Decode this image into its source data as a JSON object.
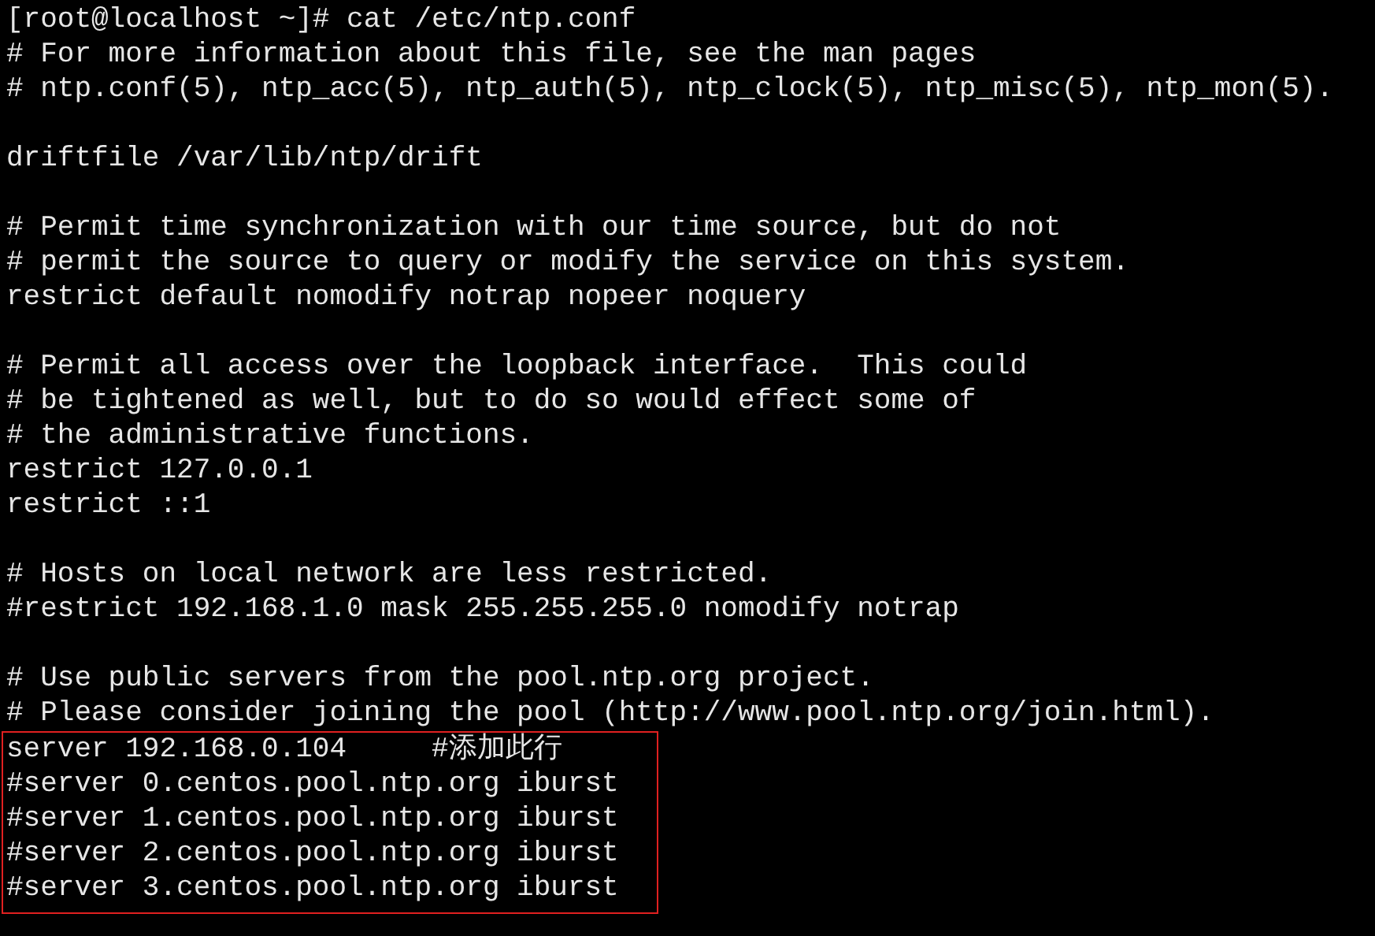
{
  "terminal": {
    "blocks": [
      {
        "lines": [
          "[root@localhost ~]# cat /etc/ntp.conf",
          "# For more information about this file, see the man pages",
          "# ntp.conf(5), ntp_acc(5), ntp_auth(5), ntp_clock(5), ntp_misc(5), ntp_mon(5)."
        ]
      },
      {
        "lines": [
          "driftfile /var/lib/ntp/drift"
        ]
      },
      {
        "lines": [
          "# Permit time synchronization with our time source, but do not",
          "# permit the source to query or modify the service on this system.",
          "restrict default nomodify notrap nopeer noquery"
        ]
      },
      {
        "lines": [
          "# Permit all access over the loopback interface.  This could",
          "# be tightened as well, but to do so would effect some of",
          "# the administrative functions.",
          "restrict 127.0.0.1",
          "restrict ::1"
        ]
      },
      {
        "lines": [
          "# Hosts on local network are less restricted.",
          "#restrict 192.168.1.0 mask 255.255.255.0 nomodify notrap"
        ]
      },
      {
        "lines": [
          "# Use public servers from the pool.ntp.org project.",
          "# Please consider joining the pool (http://www.pool.ntp.org/join.html)."
        ],
        "framed_lines": [
          "server 192.168.0.104     #添加此行",
          "#server 0.centos.pool.ntp.org iburst",
          "#server 1.centos.pool.ntp.org iburst",
          "#server 2.centos.pool.ntp.org iburst",
          "#server 3.centos.pool.ntp.org iburst"
        ]
      }
    ]
  }
}
